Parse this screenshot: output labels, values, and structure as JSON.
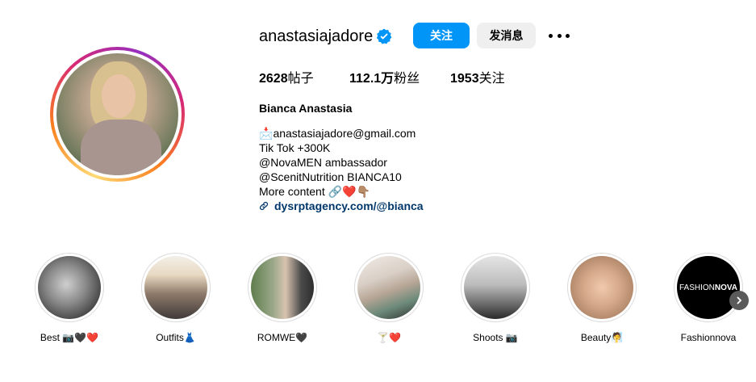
{
  "profile": {
    "username": "anastasiajadore",
    "verified_icon": "verified-badge-icon",
    "follow_label": "关注",
    "message_label": "发消息",
    "more_icon": "more-options-icon",
    "accent": "#0095f6"
  },
  "stats": {
    "posts_count": "2628",
    "posts_label": "帖子",
    "followers_count": "112.1万",
    "followers_label": "粉丝",
    "following_count": "1953",
    "following_label": "关注"
  },
  "bio": {
    "full_name": "Bianca Anastasia",
    "email_prefix": "📩",
    "email": "anastasiajadore@gmail.com",
    "line2": "Tik Tok +300K",
    "line3": "@NovaMEN ambassador",
    "line4": "@ScenitNutrition BIANCA10",
    "line5_text": "More content",
    "line5_emoji": "🔗❤️👇🏽",
    "link": "dysrptagency.com/@bianca",
    "link_color": "#00376b"
  },
  "highlights": [
    {
      "label": "Best 📷🖤❤️"
    },
    {
      "label": "Outfits👗"
    },
    {
      "label": "ROMWE🖤"
    },
    {
      "label": "🍸❤️"
    },
    {
      "label": "Shoots 📷"
    },
    {
      "label": "Beauty🧖"
    },
    {
      "label": "Fashionnova",
      "logo_a": "FASHION",
      "logo_b": "NOVA"
    }
  ]
}
